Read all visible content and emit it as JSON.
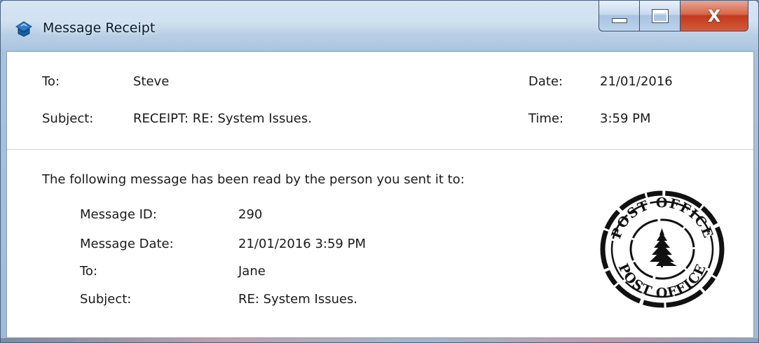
{
  "window": {
    "title": "Message Receipt",
    "icon": "message-receipt-icon"
  },
  "caption_buttons": {
    "minimize_icon": "minimize-icon",
    "maximize_icon": "maximize-icon",
    "close_label": "X"
  },
  "header": {
    "to_label": "To:",
    "to_value": "Steve",
    "subject_label": "Subject:",
    "subject_value": "RECEIPT: RE: System Issues.",
    "date_label": "Date:",
    "date_value": "21/01/2016",
    "time_label": "Time:",
    "time_value": "3:59 PM"
  },
  "body": {
    "intro": "The following message has been read by the person you sent it to:",
    "details": {
      "message_id_label": "Message ID:",
      "message_id_value": "290",
      "message_date_label": "Message Date:",
      "message_date_value": "21/01/2016 3:59 PM",
      "to_label": "To:",
      "to_value": "Jane",
      "subject_label": "Subject:",
      "subject_value": "RE: System Issues."
    }
  },
  "stamp": {
    "top_text": "POST OFFICE",
    "bottom_text": "POST OFFICE",
    "icon": "pine-tree-icon"
  },
  "colors": {
    "close_button": "#c23a1c",
    "frame": "#a9c6e4",
    "stamp_ink": "#111111"
  }
}
